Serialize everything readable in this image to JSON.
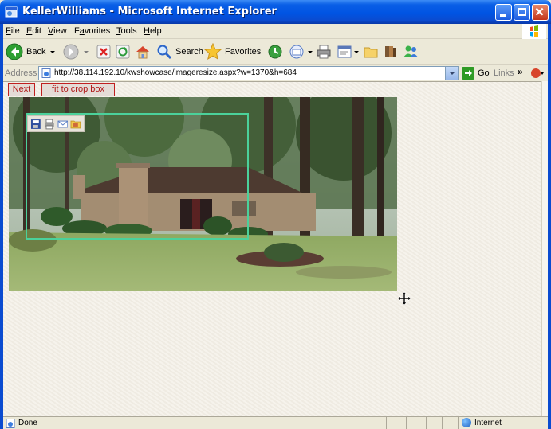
{
  "window": {
    "title": "KellerWilliams - Microsoft Internet Explorer"
  },
  "menu": [
    {
      "label": "File",
      "accel": "F",
      "rest": "ile"
    },
    {
      "label": "Edit",
      "accel": "E",
      "rest": "dit"
    },
    {
      "label": "View",
      "accel": "V",
      "rest": "iew"
    },
    {
      "label": "Favorites",
      "accel": "a",
      "pre": "F",
      "rest": "vorites"
    },
    {
      "label": "Tools",
      "accel": "T",
      "rest": "ools"
    },
    {
      "label": "Help",
      "accel": "H",
      "rest": "elp"
    }
  ],
  "toolbar": {
    "back_label": "Back",
    "search_label": "Search",
    "favorites_label": "Favorites"
  },
  "address": {
    "label": "Address",
    "url": "http://38.114.192.10/kwshowcase/imageresize.aspx?w=1370&h=684",
    "go_label": "Go",
    "links_label": "Links"
  },
  "page": {
    "next_label": "Next",
    "fit_label": "fit to crop box"
  },
  "status": {
    "text": "Done",
    "zone": "Internet"
  },
  "colors": {
    "crop_box": "#4bd19b",
    "page_button_border": "#c02020",
    "titlebar": "#0054e3"
  }
}
